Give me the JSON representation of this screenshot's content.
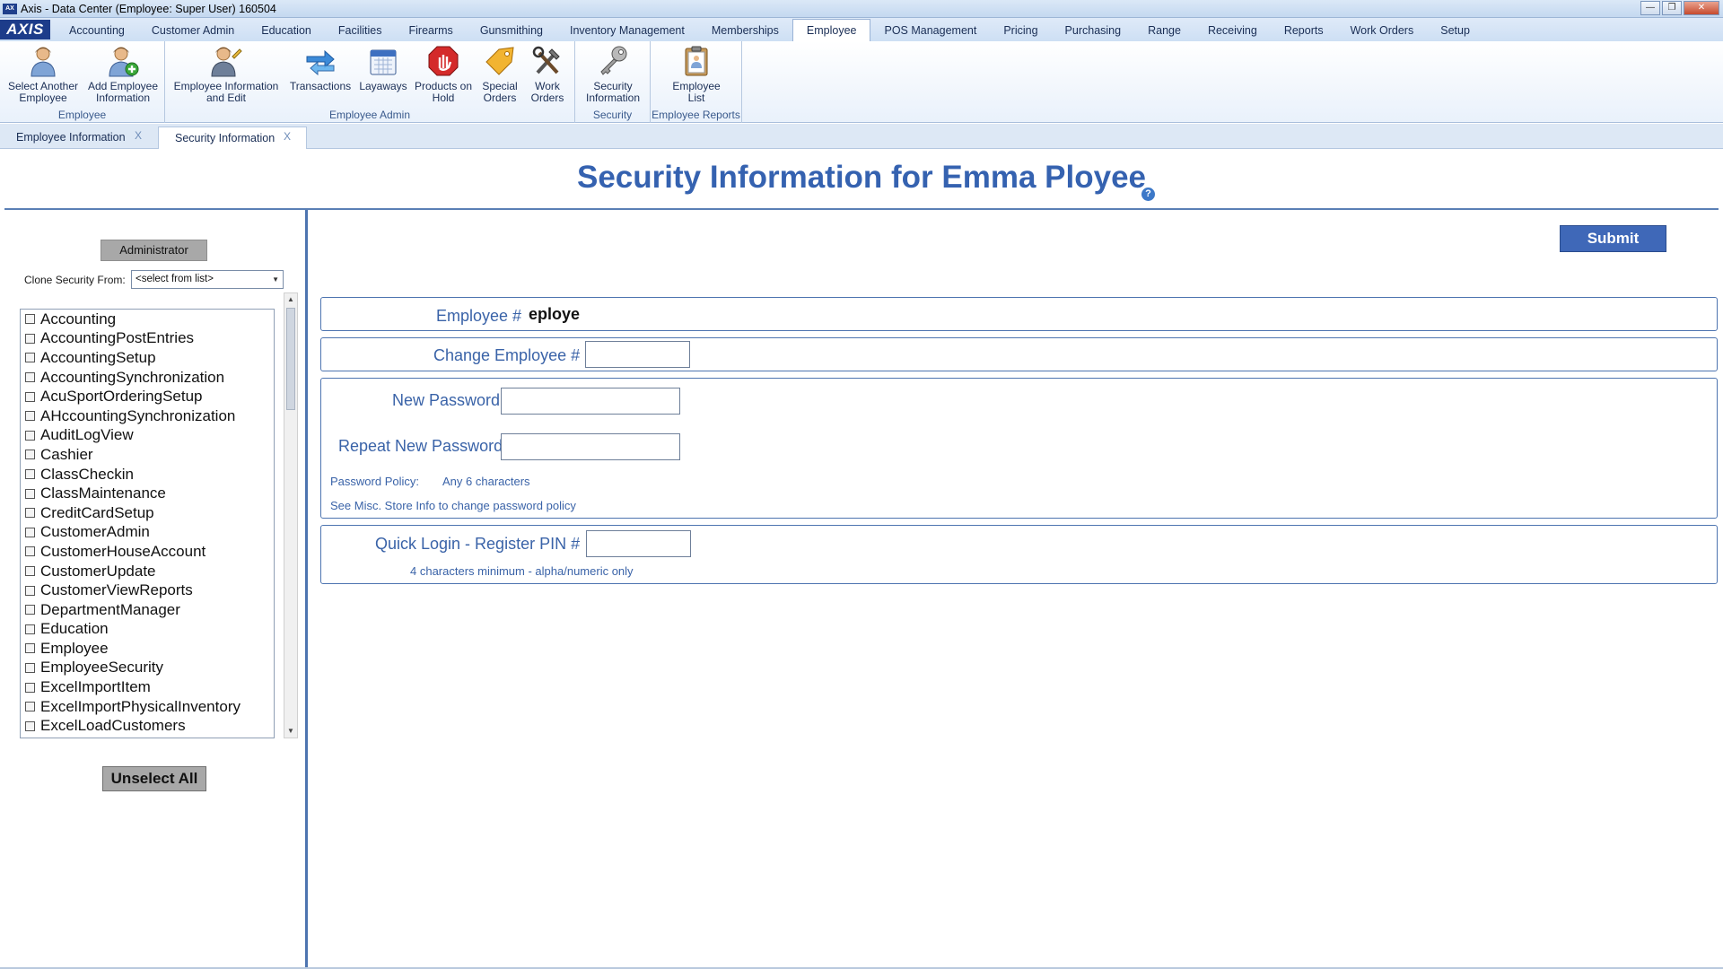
{
  "window": {
    "title": "Axis - Data Center  (Employee: Super User) 160504",
    "logo": "AXIS"
  },
  "menu": {
    "tabs": [
      "Accounting",
      "Customer Admin",
      "Education",
      "Facilities",
      "Firearms",
      "Gunsmithing",
      "Inventory Management",
      "Memberships",
      "Employee",
      "POS Management",
      "Pricing",
      "Purchasing",
      "Range",
      "Receiving",
      "Reports",
      "Work Orders",
      "Setup"
    ],
    "active": "Employee"
  },
  "ribbon": {
    "groups": [
      {
        "label": "Employee",
        "buttons": [
          {
            "line1": "Select Another",
            "line2": "Employee",
            "icon": "person-icon"
          },
          {
            "line1": "Add Employee",
            "line2": "Information",
            "icon": "person-add-icon"
          }
        ]
      },
      {
        "label": "Employee Admin",
        "buttons": [
          {
            "line1": "Employee Information",
            "line2": "and Edit",
            "icon": "person-edit-icon"
          },
          {
            "line1": "Transactions",
            "line2": "",
            "icon": "arrows-icon"
          },
          {
            "line1": "Layaways",
            "line2": "",
            "icon": "calendar-icon"
          },
          {
            "line1": "Products on",
            "line2": "Hold",
            "icon": "stop-hand-icon"
          },
          {
            "line1": "Special",
            "line2": "Orders",
            "icon": "special-tag-icon"
          },
          {
            "line1": "Work",
            "line2": "Orders",
            "icon": "tools-icon"
          }
        ]
      },
      {
        "label": "Security",
        "buttons": [
          {
            "line1": "Security",
            "line2": "Information",
            "icon": "key-icon"
          }
        ]
      },
      {
        "label": "Employee Reports",
        "buttons": [
          {
            "line1": "Employee",
            "line2": "List",
            "icon": "clipboard-icon"
          }
        ]
      }
    ]
  },
  "doc_tabs": [
    {
      "label": "Employee Information",
      "close": "X"
    },
    {
      "label": "Security Information",
      "close": "X"
    }
  ],
  "page": {
    "title": "Security Information for Emma Ployee",
    "help": "?"
  },
  "left": {
    "role_button": "Administrator",
    "clone_label": "Clone Security From:",
    "clone_value": "<select from list>",
    "permissions": [
      "Accounting",
      "AccountingPostEntries",
      "AccountingSetup",
      "AccountingSynchronization",
      "AcuSportOrderingSetup",
      "AHccountingSynchronization",
      "AuditLogView",
      "Cashier",
      "ClassCheckin",
      "ClassMaintenance",
      "CreditCardSetup",
      "CustomerAdmin",
      "CustomerHouseAccount",
      "CustomerUpdate",
      "CustomerViewReports",
      "DepartmentManager",
      "Education",
      "Employee",
      "EmployeeSecurity",
      "ExcelImportItem",
      "ExcelImportPhysicalInventory",
      "ExcelLoadCustomers"
    ],
    "unselect_all": "Unselect All"
  },
  "form": {
    "submit": "Submit",
    "employee_num_label": "Employee #",
    "employee_num_value": "eploye",
    "change_employee_label": "Change Employee #",
    "change_employee_value": "",
    "new_password_label": "New Password",
    "repeat_password_label": "Repeat New Password",
    "policy_label": "Password Policy:",
    "policy_value": "Any 6 characters",
    "policy_note": "See Misc. Store Info to change password policy",
    "pin_label": "Quick Login - Register PIN #",
    "pin_value": "",
    "pin_note": "4 characters minimum - alpha/numeric only"
  },
  "colors": {
    "accent": "#3562b0",
    "border": "#4d74b0",
    "submit": "#3f68b8"
  }
}
